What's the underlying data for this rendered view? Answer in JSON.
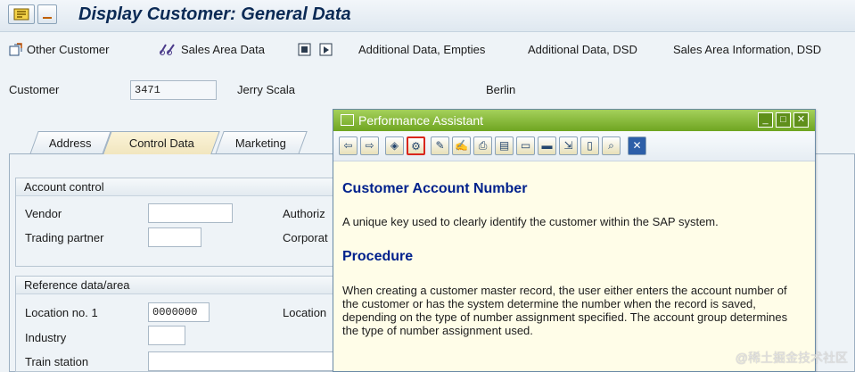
{
  "window": {
    "title": "Display Customer: General Data"
  },
  "toolbar": {
    "other_customer": "Other Customer",
    "sales_area_data": "Sales Area Data",
    "additional_data_empties": "Additional Data, Empties",
    "additional_data_dsd": "Additional Data, DSD",
    "sales_area_information_dsd": "Sales Area Information, DSD"
  },
  "header": {
    "customer_label": "Customer",
    "customer_number": "3471",
    "customer_name": "Jerry Scala",
    "city": "Berlin"
  },
  "tabs": [
    {
      "label": "Address"
    },
    {
      "label": "Control Data"
    },
    {
      "label": "Marketing"
    }
  ],
  "account_control": {
    "title": "Account control",
    "vendor_label": "Vendor",
    "vendor_value": "",
    "authoriz_label": "Authoriz",
    "trading_partner_label": "Trading partner",
    "trading_partner_value": "",
    "corporat_label": "Corporat"
  },
  "reference_data": {
    "title": "Reference data/area",
    "location_no_label": "Location no. 1",
    "location_no_value": "0000000",
    "location_label": "Location",
    "industry_label": "Industry",
    "industry_value": "",
    "train_station_label": "Train station",
    "train_station_value": ""
  },
  "performance_assistant": {
    "title": "Performance Assistant",
    "heading": "Customer Account Number",
    "intro": "A unique key used to clearly identify the customer within the SAP system.",
    "procedure_heading": "Procedure",
    "procedure_text": "When creating a customer master record, the user either enters the account number of the customer or has the system determine the number when the record is saved, depending on the type of number assignment specified. The account group determines the type of number assignment used."
  },
  "watermark": "@稀土掘金技术社区",
  "colors": {
    "accent_green": "#7ab02c",
    "heading_blue": "#00218c",
    "active_tab": "#f1e6bf"
  }
}
